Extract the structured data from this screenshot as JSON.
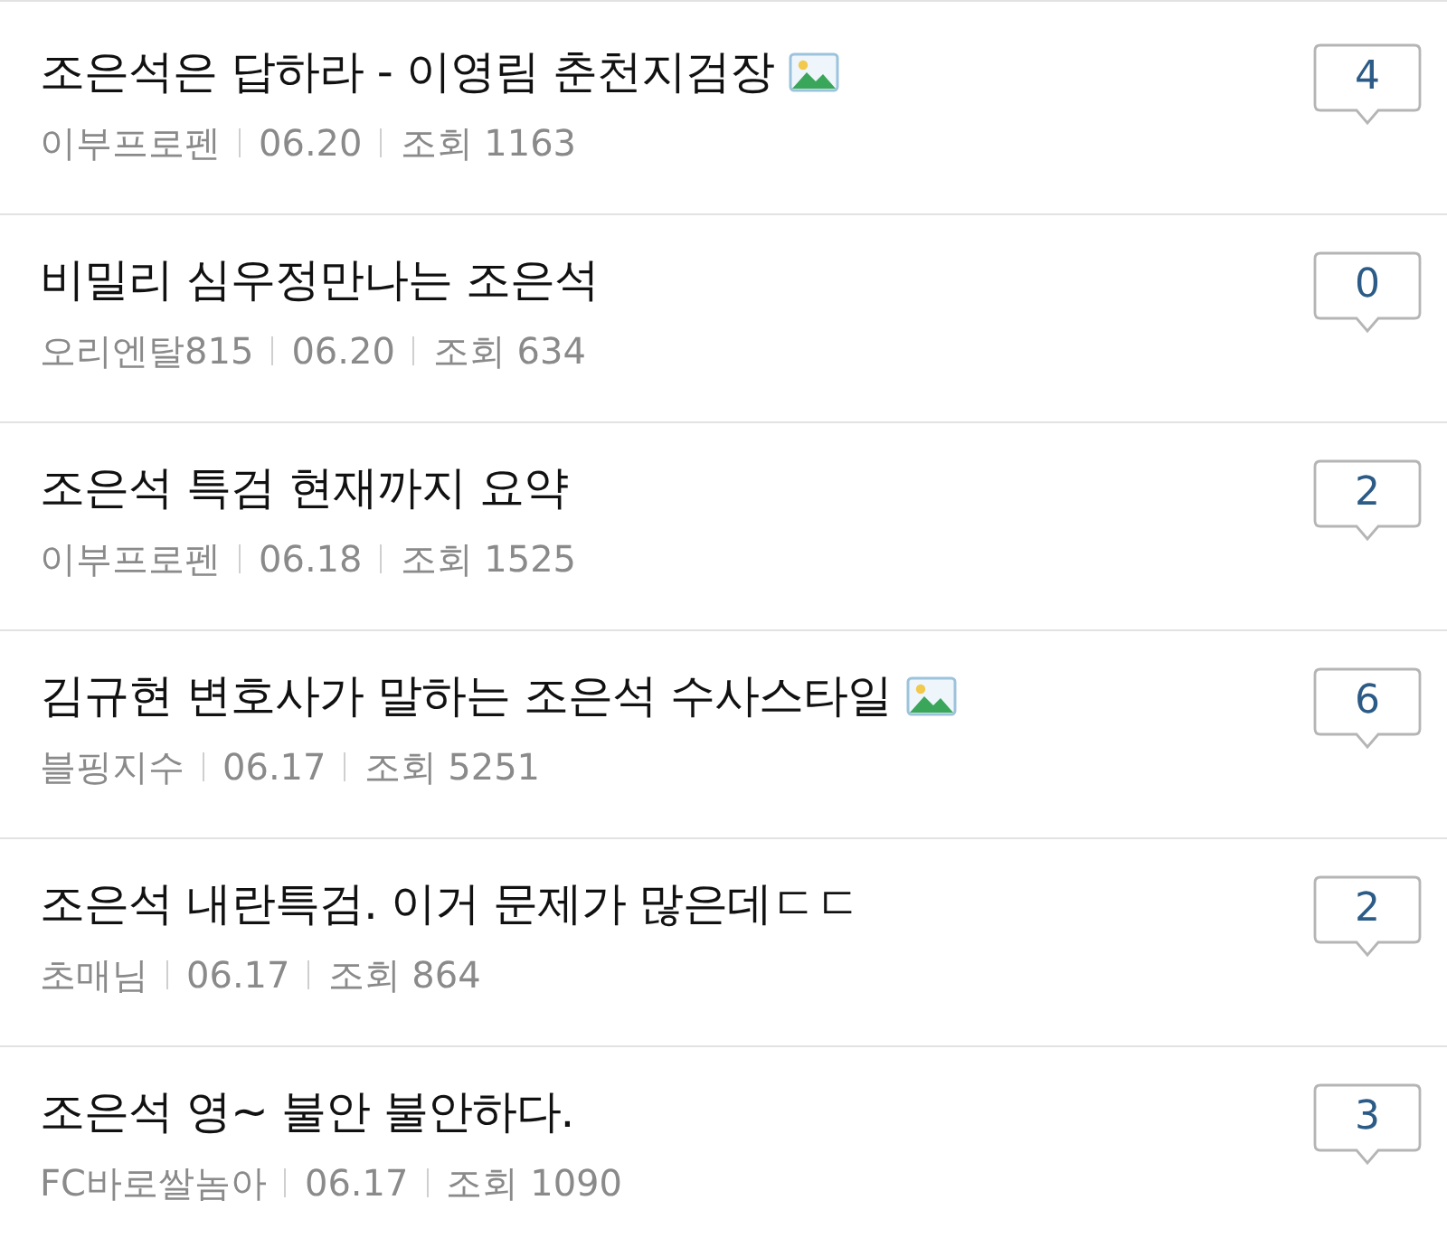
{
  "posts": [
    {
      "title": "조은석은 답하라 - 이영림 춘천지검장",
      "has_image": true,
      "author": "이부프로펜",
      "date": "06.20",
      "views_label": "조회",
      "views": "1163",
      "comments": "4"
    },
    {
      "title": "비밀리 심우정만나는 조은석",
      "has_image": false,
      "author": "오리엔탈815",
      "date": "06.20",
      "views_label": "조회",
      "views": "634",
      "comments": "0"
    },
    {
      "title": "조은석 특검 현재까지 요약",
      "has_image": false,
      "author": "이부프로펜",
      "date": "06.18",
      "views_label": "조회",
      "views": "1525",
      "comments": "2"
    },
    {
      "title": "김규현 변호사가 말하는 조은석 수사스타일",
      "has_image": true,
      "author": "블핑지수",
      "date": "06.17",
      "views_label": "조회",
      "views": "5251",
      "comments": "6"
    },
    {
      "title": "조은석 내란특검. 이거 문제가 많은데ㄷㄷ",
      "has_image": false,
      "author": "초매님",
      "date": "06.17",
      "views_label": "조회",
      "views": "864",
      "comments": "2"
    },
    {
      "title": "조은석 영~ 불안 불안하다.",
      "has_image": false,
      "author": "FC바로쌀놈아",
      "date": "06.17",
      "views_label": "조회",
      "views": "1090",
      "comments": "3"
    }
  ]
}
